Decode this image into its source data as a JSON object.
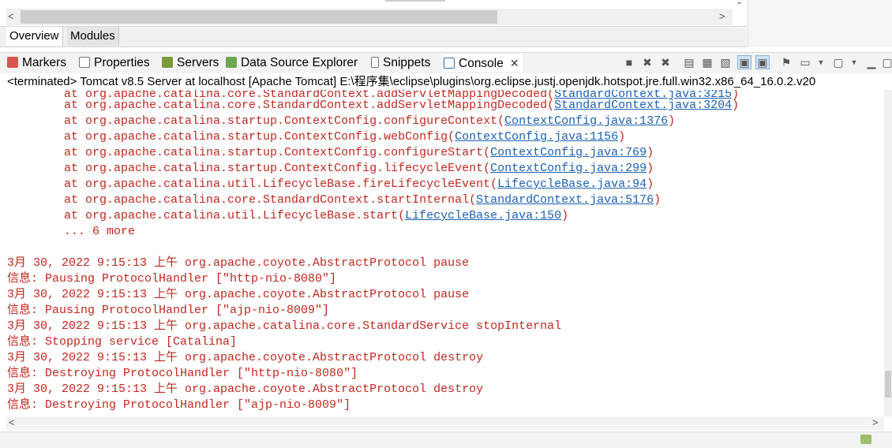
{
  "editor_tabs": {
    "overview": "Overview",
    "modules": "Modules"
  },
  "view_tabs": {
    "markers": "Markers",
    "properties": "Properties",
    "servers": "Servers",
    "datasource": "Data Source Explorer",
    "snippets": "Snippets",
    "console": "Console"
  },
  "terminated": "<terminated> Tomcat v8.5 Server at localhost [Apache Tomcat] E:\\程序集\\eclipse\\plugins\\org.eclipse.justj.openjdk.hotspot.jre.full.win32.x86_64_16.0.2.v20",
  "console": {
    "trace": [
      {
        "pre": "        at org.apache.catalina.core.StandardContext.addServletMappingDecoded(",
        "link": "StandardContext.java:3215",
        "post": ")"
      },
      {
        "pre": "        at org.apache.catalina.core.StandardContext.addServletMappingDecoded(",
        "link": "StandardContext.java:3204",
        "post": ")"
      },
      {
        "pre": "        at org.apache.catalina.startup.ContextConfig.configureContext(",
        "link": "ContextConfig.java:1376",
        "post": ")"
      },
      {
        "pre": "        at org.apache.catalina.startup.ContextConfig.webConfig(",
        "link": "ContextConfig.java:1156",
        "post": ")"
      },
      {
        "pre": "        at org.apache.catalina.startup.ContextConfig.configureStart(",
        "link": "ContextConfig.java:769",
        "post": ")"
      },
      {
        "pre": "        at org.apache.catalina.startup.ContextConfig.lifecycleEvent(",
        "link": "ContextConfig.java:299",
        "post": ")"
      },
      {
        "pre": "        at org.apache.catalina.util.LifecycleBase.fireLifecycleEvent(",
        "link": "LifecycleBase.java:94",
        "post": ")"
      },
      {
        "pre": "        at org.apache.catalina.core.StandardContext.startInternal(",
        "link": "StandardContext.java:5176",
        "post": ")"
      },
      {
        "pre": "        at org.apache.catalina.util.LifecycleBase.start(",
        "link": "LifecycleBase.java:150",
        "post": ")"
      }
    ],
    "more": "        ... 6 more",
    "log": [
      "3月 30, 2022 9:15:13 上午 org.apache.coyote.AbstractProtocol pause",
      "信息: Pausing ProtocolHandler [\"http-nio-8080\"]",
      "3月 30, 2022 9:15:13 上午 org.apache.coyote.AbstractProtocol pause",
      "信息: Pausing ProtocolHandler [\"ajp-nio-8009\"]",
      "3月 30, 2022 9:15:13 上午 org.apache.catalina.core.StandardService stopInternal",
      "信息: Stopping service [Catalina]",
      "3月 30, 2022 9:15:13 上午 org.apache.coyote.AbstractProtocol destroy",
      "信息: Destroying ProtocolHandler [\"http-nio-8080\"]",
      "3月 30, 2022 9:15:13 上午 org.apache.coyote.AbstractProtocol destroy",
      "信息: Destroying ProtocolHandler [\"ajp-nio-8009\"]"
    ]
  },
  "colors": {
    "error_text": "#c0281f",
    "link": "#1a5fb4"
  }
}
